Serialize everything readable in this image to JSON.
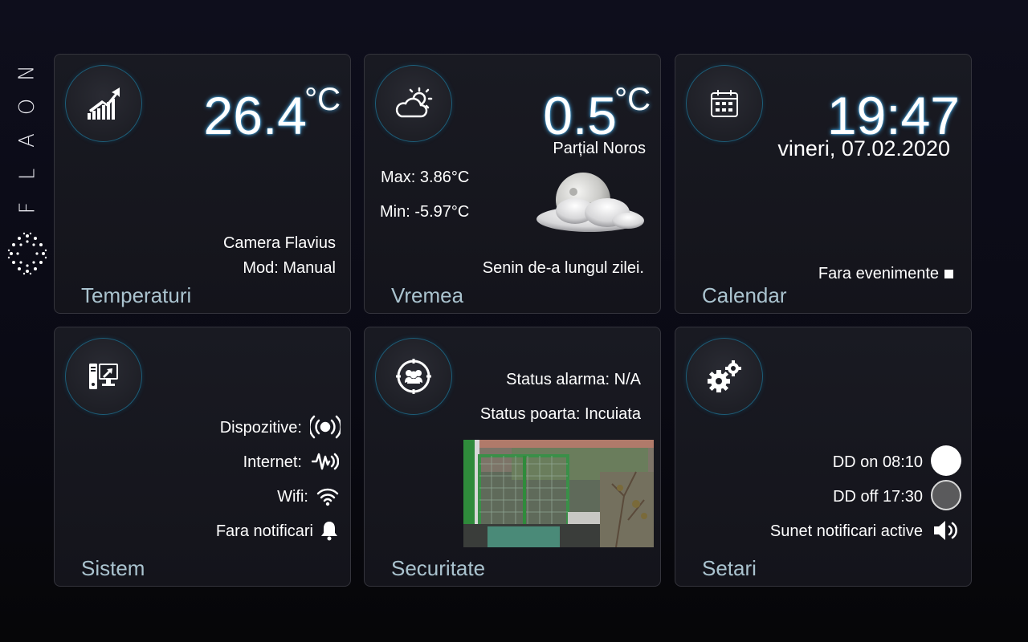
{
  "brand": {
    "letters": [
      "N",
      "O",
      "A",
      "L",
      "F"
    ]
  },
  "tiles": {
    "temperatures": {
      "title": "Temperaturi",
      "value": "26.4",
      "unit": "°C",
      "room": "Camera Flavius",
      "mode": "Mod: Manual"
    },
    "weather": {
      "title": "Vremea",
      "value": "0.5",
      "unit": "°C",
      "condition": "Parțial Noros",
      "max": "Max: 3.86°C",
      "min": "Min: -5.97°C",
      "summary": "Senin de-a lungul zilei."
    },
    "calendar": {
      "title": "Calendar",
      "time": "19:47",
      "date": "vineri, 07.02.2020",
      "events": "Fara evenimente"
    },
    "system": {
      "title": "Sistem",
      "devices": "Dispozitive:",
      "internet": "Internet:",
      "wifi": "Wifi:",
      "notifications": "Fara notificari"
    },
    "security": {
      "title": "Securitate",
      "alarm": "Status alarma: N/A",
      "gate": "Status poarta: Incuiata"
    },
    "settings": {
      "title": "Setari",
      "dd_on": "DD on 08:10",
      "dd_off": "DD off 17:30",
      "sound": "Sunet notificari active"
    }
  },
  "colors": {
    "glow": "#50beff",
    "icon_ring": "#1d5d78",
    "title": "#aac3cf"
  }
}
